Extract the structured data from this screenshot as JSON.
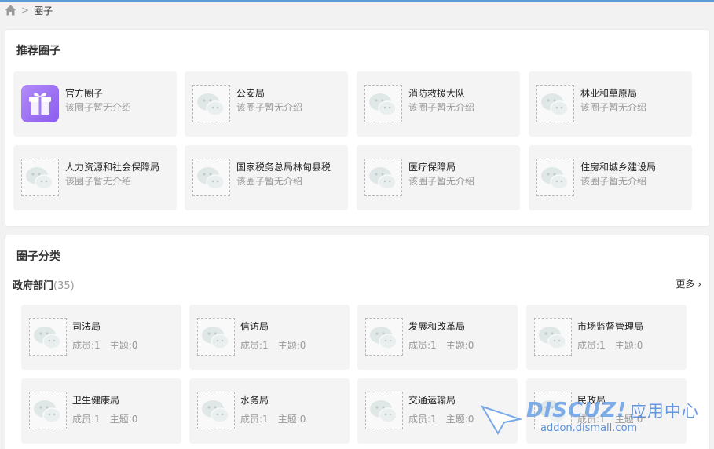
{
  "breadcrumb": {
    "home_icon": "home-icon",
    "current": "圈子"
  },
  "recommend": {
    "title": "推荐圈子",
    "cards": [
      {
        "name": "官方圈子",
        "desc": "该圈子暂无介绍",
        "icon": "gift-icon"
      },
      {
        "name": "公安局",
        "desc": "该圈子暂无介绍",
        "icon": "wechat-placeholder-icon"
      },
      {
        "name": "消防救援大队",
        "desc": "该圈子暂无介绍",
        "icon": "wechat-placeholder-icon"
      },
      {
        "name": "林业和草原局",
        "desc": "该圈子暂无介绍",
        "icon": "wechat-placeholder-icon"
      },
      {
        "name": "人力资源和社会保障局",
        "desc": "该圈子暂无介绍",
        "icon": "wechat-placeholder-icon"
      },
      {
        "name": "国家税务总局林甸县税",
        "desc": "该圈子暂无介绍",
        "icon": "wechat-placeholder-icon"
      },
      {
        "name": "医疗保障局",
        "desc": "该圈子暂无介绍",
        "icon": "wechat-placeholder-icon"
      },
      {
        "name": "住房和城乡建设局",
        "desc": "该圈子暂无介绍",
        "icon": "wechat-placeholder-icon"
      }
    ]
  },
  "categories": {
    "title": "圈子分类",
    "group": {
      "name": "政府部门",
      "count": "(35)",
      "more": "更多 ›",
      "cards": [
        {
          "name": "司法局",
          "members": "成员:1",
          "topics": "主题:0"
        },
        {
          "name": "信访局",
          "members": "成员:1",
          "topics": "主题:0"
        },
        {
          "name": "发展和改革局",
          "members": "成员:1",
          "topics": "主题:0"
        },
        {
          "name": "市场监督管理局",
          "members": "成员:1",
          "topics": "主题:0"
        },
        {
          "name": "卫生健康局",
          "members": "成员:1",
          "topics": "主题:0"
        },
        {
          "name": "水务局",
          "members": "成员:1",
          "topics": "主题:0"
        },
        {
          "name": "交通运输局",
          "members": "成员:1",
          "topics": "主题:0"
        },
        {
          "name": "民政局",
          "members": "成员:1",
          "topics": "主题:0"
        }
      ]
    }
  },
  "watermark": {
    "logo": "DISCUZ!",
    "cn": "应用中心",
    "url": "addon.dismall.com"
  },
  "colors": {
    "accent": "#5c9bd6",
    "card_bg": "#f4f4f4",
    "muted": "#999999"
  }
}
